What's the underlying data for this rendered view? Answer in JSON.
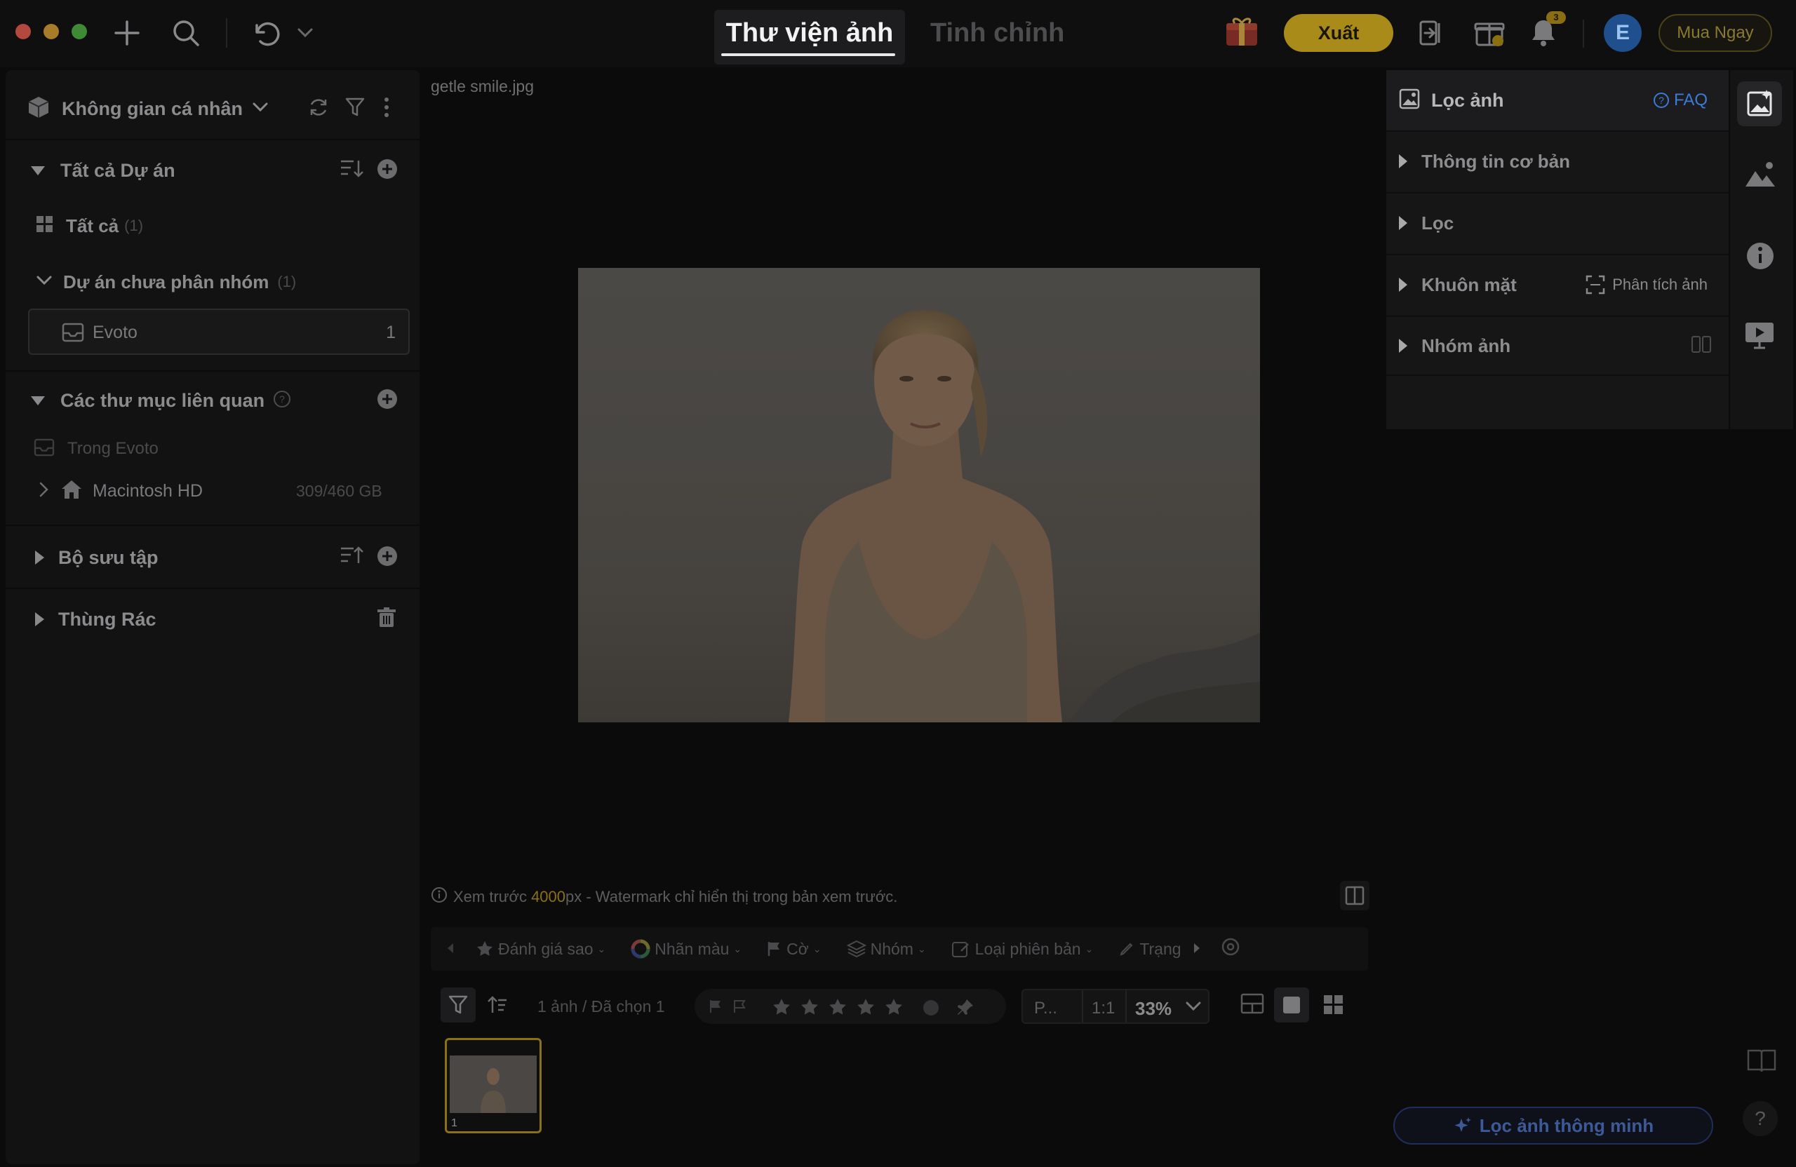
{
  "titlebar": {
    "tab_library": "Thư viện ảnh",
    "tab_edit": "Tinh chỉnh",
    "export_label": "Xuất",
    "avatar_initial": "E",
    "buy_label": "Mua Ngay",
    "notification_count": "3"
  },
  "sidebar": {
    "workspace": "Không gian cá nhân",
    "all_projects": "Tất cả Dự án",
    "all_label": "Tất cả",
    "all_count": "(1)",
    "ungrouped_label": "Dự án chưa phân nhóm",
    "ungrouped_count": "(1)",
    "evoto_label": "Evoto",
    "evoto_count": "1",
    "folders_title": "Các thư mục liên quan",
    "in_evoto": "Trong Evoto",
    "disk_name": "Macintosh HD",
    "disk_usage": "309/460 GB",
    "collections_title": "Bộ sưu tập",
    "trash_title": "Thùng Rác"
  },
  "viewer": {
    "filename": "getle smile.jpg",
    "preview_prefix": "Xem trước ",
    "preview_px": "4000",
    "preview_suffix": "px - Watermark chỉ hiển thị trong bản xem trước."
  },
  "filterbar": {
    "rating": "Đánh giá sao",
    "color": "Nhãn màu",
    "flag": "Cờ",
    "group": "Nhóm",
    "version": "Loại phiên bản",
    "status": "Trạng"
  },
  "bottombar": {
    "count_text": "1 ảnh / Đã chọn 1",
    "view_p": "P...",
    "view_11": "1:1",
    "zoom": "33%",
    "thumb_index": "1"
  },
  "rightpanel": {
    "title": "Lọc ảnh",
    "faq": "FAQ",
    "basic_info": "Thông tin cơ bản",
    "filter": "Lọc",
    "faces": "Khuôn mặt",
    "analyze": "Phân tích ảnh",
    "groups": "Nhóm ảnh",
    "smart_filter": "Lọc ảnh thông minh",
    "help": "?"
  },
  "colors": {
    "accent_gold": "#a98b1a",
    "accent_blue": "#3a7bd5"
  }
}
